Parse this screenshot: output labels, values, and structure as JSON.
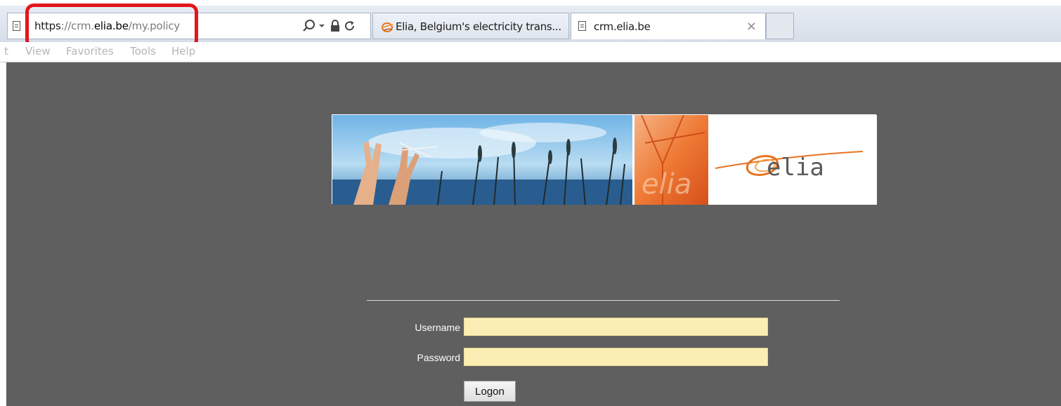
{
  "browser": {
    "address": {
      "scheme": "https",
      "separator": "://",
      "subdomain": "crm.",
      "domain": "elia.be",
      "path": "/my.policy"
    },
    "tabs": [
      {
        "label": "Elia, Belgium's electricity trans...",
        "active": false
      },
      {
        "label": "crm.elia.be",
        "active": true,
        "close_glyph": "×"
      }
    ],
    "menu": [
      "t",
      "View",
      "Favorites",
      "Tools",
      "Help"
    ],
    "icons": [
      "page-icon",
      "search-icon",
      "dropdown-arrow-icon",
      "lock-icon",
      "refresh-icon",
      "elia-favicon",
      "close-icon"
    ]
  },
  "page": {
    "banner": {
      "logo_text": "elia",
      "watermark_text": "elia"
    },
    "form": {
      "username_label": "Username",
      "password_label": "Password",
      "username_value": "",
      "password_value": "",
      "submit_label": "Logon"
    }
  },
  "colors": {
    "page_background": "#5f5f5f",
    "input_background": "#fbeeb5",
    "highlight_outline": "#e2161b",
    "brand_orange": "#e8731f"
  }
}
